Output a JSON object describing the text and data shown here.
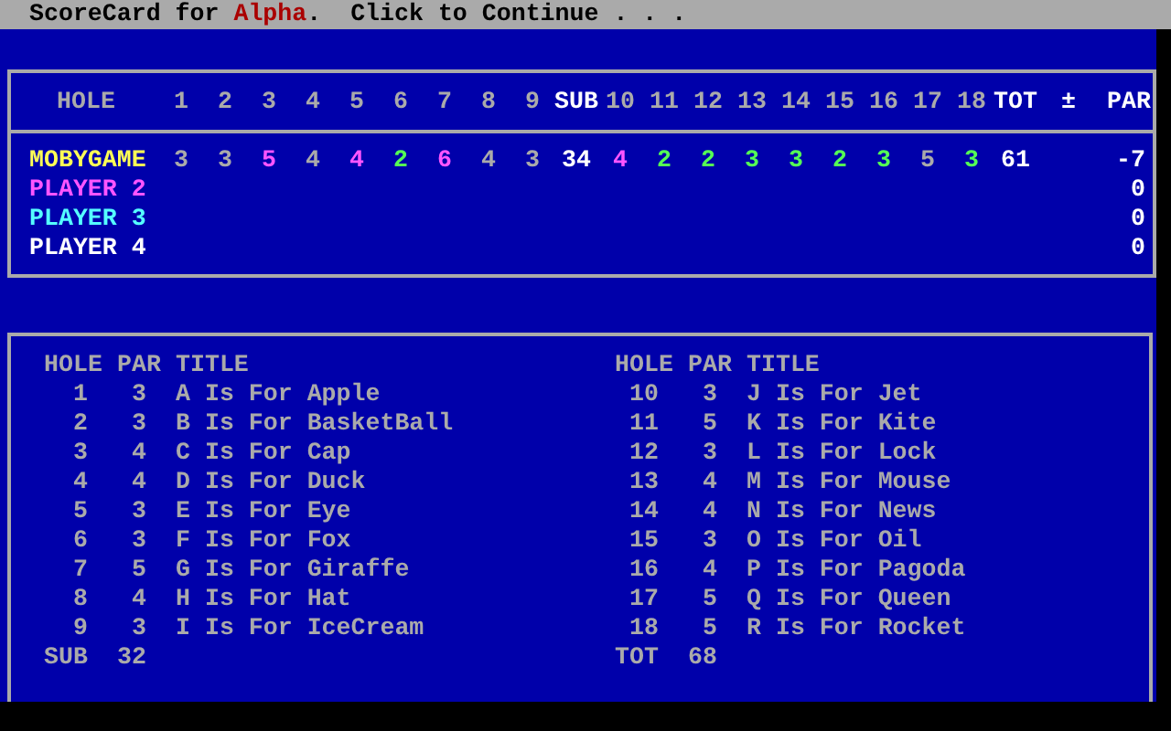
{
  "title_bar": {
    "prefix": "ScoreCard for ",
    "course": "Alpha",
    "suffix": ".  Click to Continue . . ."
  },
  "scorecard": {
    "name_header": "HOLE",
    "columns": [
      {
        "label": "1",
        "kind": "hole"
      },
      {
        "label": "2",
        "kind": "hole"
      },
      {
        "label": "3",
        "kind": "hole"
      },
      {
        "label": "4",
        "kind": "hole"
      },
      {
        "label": "5",
        "kind": "hole"
      },
      {
        "label": "6",
        "kind": "hole"
      },
      {
        "label": "7",
        "kind": "hole"
      },
      {
        "label": "8",
        "kind": "hole"
      },
      {
        "label": "9",
        "kind": "hole"
      },
      {
        "label": "SUB",
        "kind": "total"
      },
      {
        "label": "10",
        "kind": "hole"
      },
      {
        "label": "11",
        "kind": "hole"
      },
      {
        "label": "12",
        "kind": "hole"
      },
      {
        "label": "13",
        "kind": "hole"
      },
      {
        "label": "14",
        "kind": "hole"
      },
      {
        "label": "15",
        "kind": "hole"
      },
      {
        "label": "16",
        "kind": "hole"
      },
      {
        "label": "17",
        "kind": "hole"
      },
      {
        "label": "18",
        "kind": "hole"
      },
      {
        "label": "TOT",
        "kind": "total"
      }
    ],
    "diff_symbol": "±",
    "par_label": "PAR",
    "players": [
      {
        "name": "MOBYGAME",
        "color": "#ffff55",
        "sub": "34",
        "tot": "61",
        "par_diff": "-7",
        "scores": [
          {
            "value": "3",
            "color": "#aaaaaa"
          },
          {
            "value": "3",
            "color": "#aaaaaa"
          },
          {
            "value": "5",
            "color": "#ff55ff"
          },
          {
            "value": "4",
            "color": "#aaaaaa"
          },
          {
            "value": "4",
            "color": "#ff55ff"
          },
          {
            "value": "2",
            "color": "#55ff55"
          },
          {
            "value": "6",
            "color": "#ff55ff"
          },
          {
            "value": "4",
            "color": "#aaaaaa"
          },
          {
            "value": "3",
            "color": "#aaaaaa"
          },
          {
            "value": "4",
            "color": "#ff55ff"
          },
          {
            "value": "2",
            "color": "#55ff55"
          },
          {
            "value": "2",
            "color": "#55ff55"
          },
          {
            "value": "3",
            "color": "#55ff55"
          },
          {
            "value": "3",
            "color": "#55ff55"
          },
          {
            "value": "2",
            "color": "#55ff55"
          },
          {
            "value": "3",
            "color": "#55ff55"
          },
          {
            "value": "5",
            "color": "#aaaaaa"
          },
          {
            "value": "3",
            "color": "#55ff55"
          }
        ]
      },
      {
        "name": "PLAYER 2",
        "color": "#ff55ff",
        "par_diff": "0"
      },
      {
        "name": "PLAYER 3",
        "color": "#55ffff",
        "par_diff": "0"
      },
      {
        "name": "PLAYER 4",
        "color": "#ffffff",
        "par_diff": "0"
      }
    ]
  },
  "course_holes": [
    {
      "headers": [
        "HOLE",
        "PAR",
        "TITLE"
      ],
      "footer_label": "SUB",
      "footer_value": "32",
      "rows": [
        {
          "hole": "1",
          "par": "3",
          "title": "A Is For Apple"
        },
        {
          "hole": "2",
          "par": "3",
          "title": "B Is For BasketBall"
        },
        {
          "hole": "3",
          "par": "4",
          "title": "C Is For Cap"
        },
        {
          "hole": "4",
          "par": "4",
          "title": "D Is For Duck"
        },
        {
          "hole": "5",
          "par": "3",
          "title": "E Is For Eye"
        },
        {
          "hole": "6",
          "par": "3",
          "title": "F Is For Fox"
        },
        {
          "hole": "7",
          "par": "5",
          "title": "G Is For Giraffe"
        },
        {
          "hole": "8",
          "par": "4",
          "title": "H Is For Hat"
        },
        {
          "hole": "9",
          "par": "3",
          "title": "I Is For IceCream"
        }
      ]
    },
    {
      "headers": [
        "HOLE",
        "PAR",
        "TITLE"
      ],
      "footer_label": "TOT",
      "footer_value": "68",
      "rows": [
        {
          "hole": "10",
          "par": "3",
          "title": "J Is For Jet"
        },
        {
          "hole": "11",
          "par": "5",
          "title": "K Is For Kite"
        },
        {
          "hole": "12",
          "par": "3",
          "title": "L Is For Lock"
        },
        {
          "hole": "13",
          "par": "4",
          "title": "M Is For Mouse"
        },
        {
          "hole": "14",
          "par": "4",
          "title": "N Is For News"
        },
        {
          "hole": "15",
          "par": "3",
          "title": "O Is For Oil"
        },
        {
          "hole": "16",
          "par": "4",
          "title": "P Is For Pagoda"
        },
        {
          "hole": "17",
          "par": "5",
          "title": "Q Is For Queen"
        },
        {
          "hole": "18",
          "par": "5",
          "title": "R Is For Rocket"
        }
      ]
    }
  ]
}
